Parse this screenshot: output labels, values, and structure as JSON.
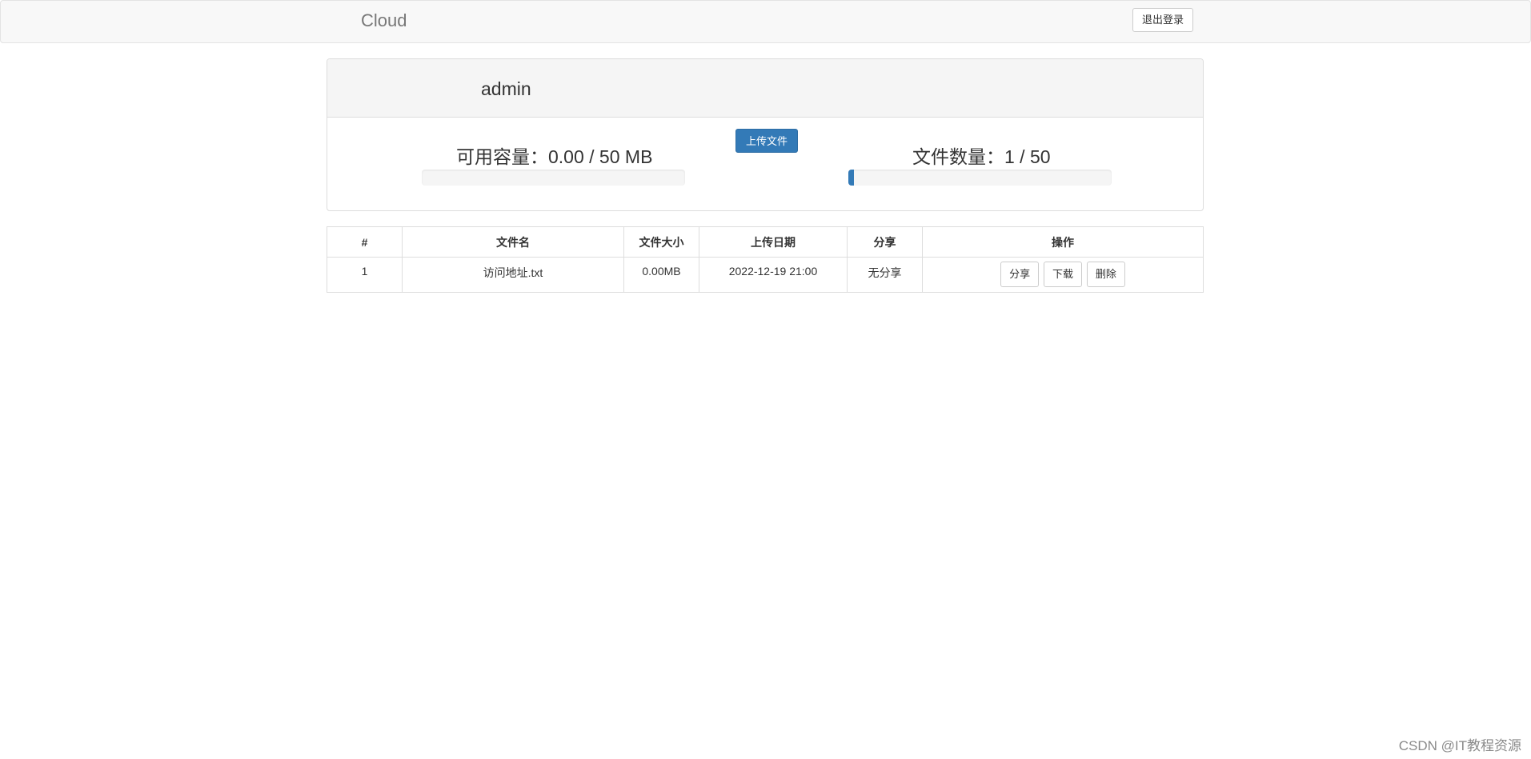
{
  "navbar": {
    "brand": "Cloud",
    "logout_label": "退出登录"
  },
  "panel": {
    "username": "admin",
    "capacity_text": "可用容量：0.00 / 50 MB",
    "capacity_fraction": 0.0,
    "upload_label": "上传文件",
    "file_count_text": "文件数量：1 / 50",
    "file_count_fraction": 0.02,
    "accent_color": "#337ab7"
  },
  "table": {
    "headers": [
      "#",
      "文件名",
      "文件大小",
      "上传日期",
      "分享",
      "操作"
    ],
    "rows": [
      {
        "index": "1",
        "name": "访问地址.txt",
        "size": "0.00MB",
        "date": "2022-12-19 21:00",
        "share": "无分享",
        "actions": [
          "分享",
          "下载",
          "删除"
        ]
      }
    ]
  },
  "watermark": "CSDN @IT教程资源"
}
